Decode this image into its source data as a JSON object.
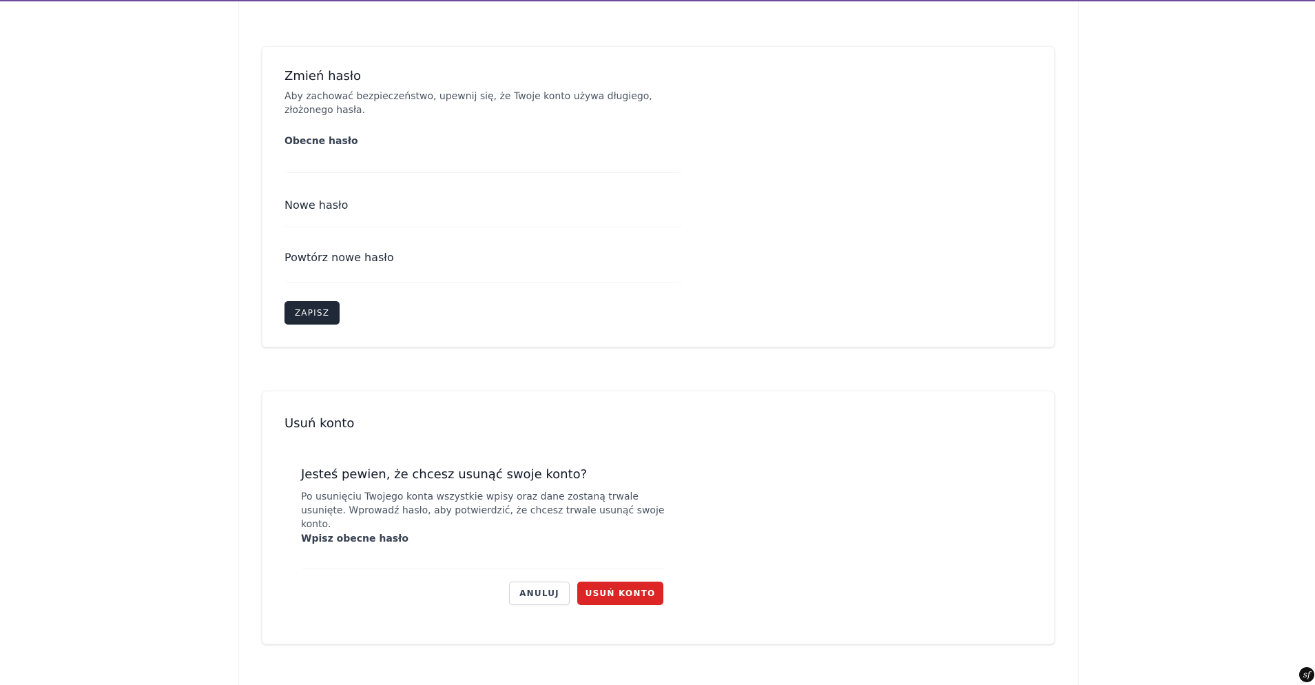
{
  "change_password": {
    "title": "Zmień hasło",
    "description": "Aby zachować bezpieczeństwo, upewnij się, że Twoje konto używa długiego, złożonego hasła.",
    "current_password_label": "Obecne hasło",
    "current_password_value": "",
    "new_password_label": "Nowe hasło",
    "new_password_value": "",
    "repeat_password_label": "Powtórz nowe hasło",
    "repeat_password_value": "",
    "save_label": "ZAPISZ"
  },
  "delete_account": {
    "title": "Usuń konto",
    "modal": {
      "title": "Jesteś pewien, że chcesz usunąć swoje konto?",
      "description": "Po usunięciu Twojego konta wszystkie wpisy oraz dane zostaną trwale usunięte. Wprowadź hasło, aby potwierdzić, że chcesz trwale usunąć swoje konto.",
      "password_label": "Wpisz obecne hasło",
      "password_value": "",
      "cancel_label": "ANULUJ",
      "confirm_label": "USUŃ KONTO"
    }
  },
  "debug_toolbar": {
    "icon": "symfony-icon",
    "glyph": "sf"
  },
  "colors": {
    "accent_line": "#6b4e9b",
    "primary_button": "#1f2937",
    "danger_button": "#dc2626"
  }
}
